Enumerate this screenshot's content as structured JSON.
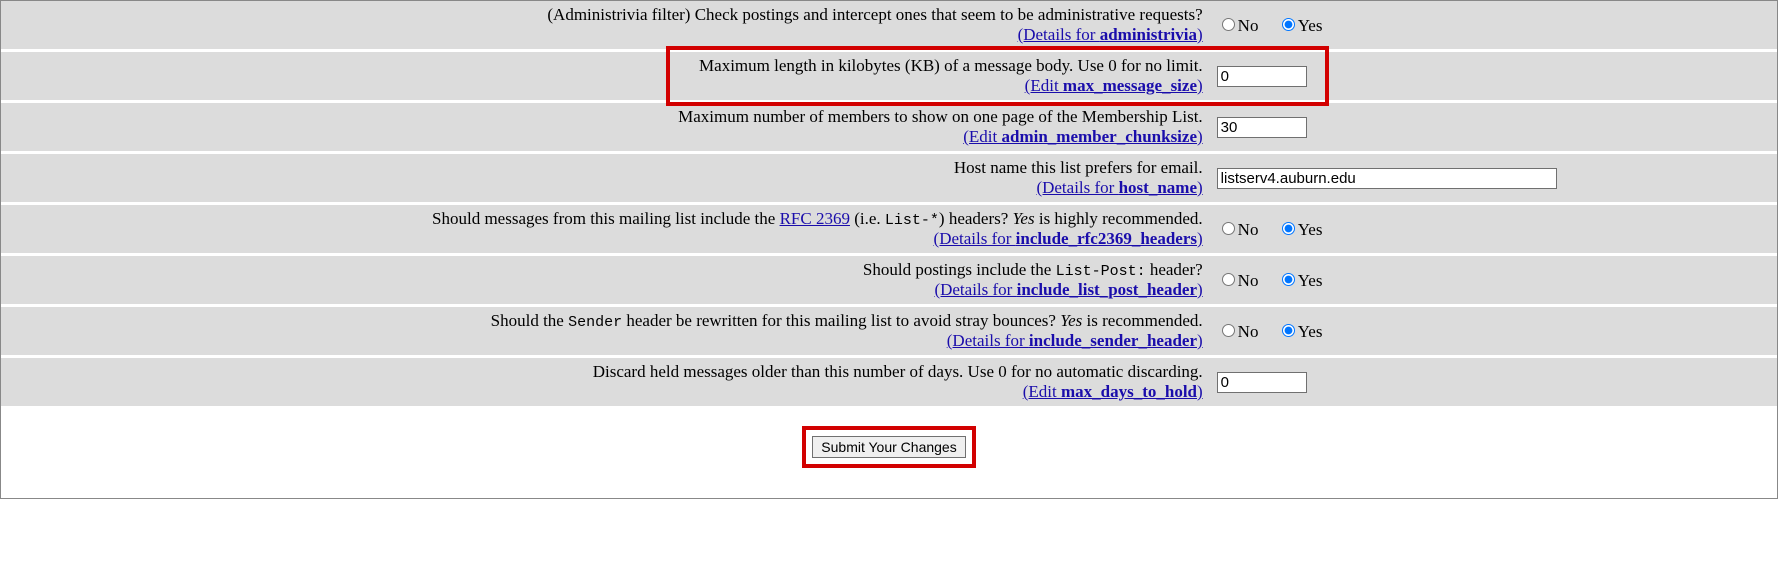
{
  "rows": {
    "administrivia": {
      "text": "(Administrivia filter) Check postings and intercept ones that seem to be administrative requests?",
      "link_prefix": "(Details for ",
      "link_key": "administrivia",
      "link_suffix": ")",
      "no": "No",
      "yes": "Yes"
    },
    "max_message_size": {
      "text": "Maximum length in kilobytes (KB) of a message body. Use 0 for no limit.",
      "link_prefix": "(Edit ",
      "link_key": "max_message_size",
      "link_suffix": ")",
      "value": "0"
    },
    "admin_member_chunksize": {
      "text": "Maximum number of members to show on one page of the Membership List.",
      "link_prefix": "(Edit ",
      "link_key": "admin_member_chunksize",
      "link_suffix": ")",
      "value": "30"
    },
    "host_name": {
      "text": "Host name this list prefers for email.",
      "link_prefix": "(Details for ",
      "link_key": "host_name",
      "link_suffix": ")",
      "value": "listserv4.auburn.edu"
    },
    "include_rfc2369_headers": {
      "text_a": "Should messages from this mailing list include the ",
      "rfc": "RFC 2369",
      "text_b": " (i.e. ",
      "mono": "List-*",
      "text_c": ") headers? ",
      "ital": "Yes",
      "text_d": " is highly recommended.",
      "link_prefix": "(Details for ",
      "link_key": "include_rfc2369_headers",
      "link_suffix": ")",
      "no": "No",
      "yes": "Yes"
    },
    "include_list_post_header": {
      "text_a": "Should postings include the ",
      "mono": "List-Post:",
      "text_b": " header?",
      "link_prefix": "(Details for ",
      "link_key": "include_list_post_header",
      "link_suffix": ")",
      "no": "No",
      "yes": "Yes"
    },
    "include_sender_header": {
      "text_a": "Should the ",
      "mono": "Sender",
      "text_b": " header be rewritten for this mailing list to avoid stray bounces? ",
      "ital": "Yes",
      "text_c": " is recommended.",
      "link_prefix": "(Details for ",
      "link_key": "include_sender_header",
      "link_suffix": ")",
      "no": "No",
      "yes": "Yes"
    },
    "max_days_to_hold": {
      "text": "Discard held messages older than this number of days. Use 0 for no automatic discarding.",
      "link_prefix": "(Edit ",
      "link_key": "max_days_to_hold",
      "link_suffix": ")",
      "value": "0"
    }
  },
  "submit_label": "Submit Your Changes"
}
